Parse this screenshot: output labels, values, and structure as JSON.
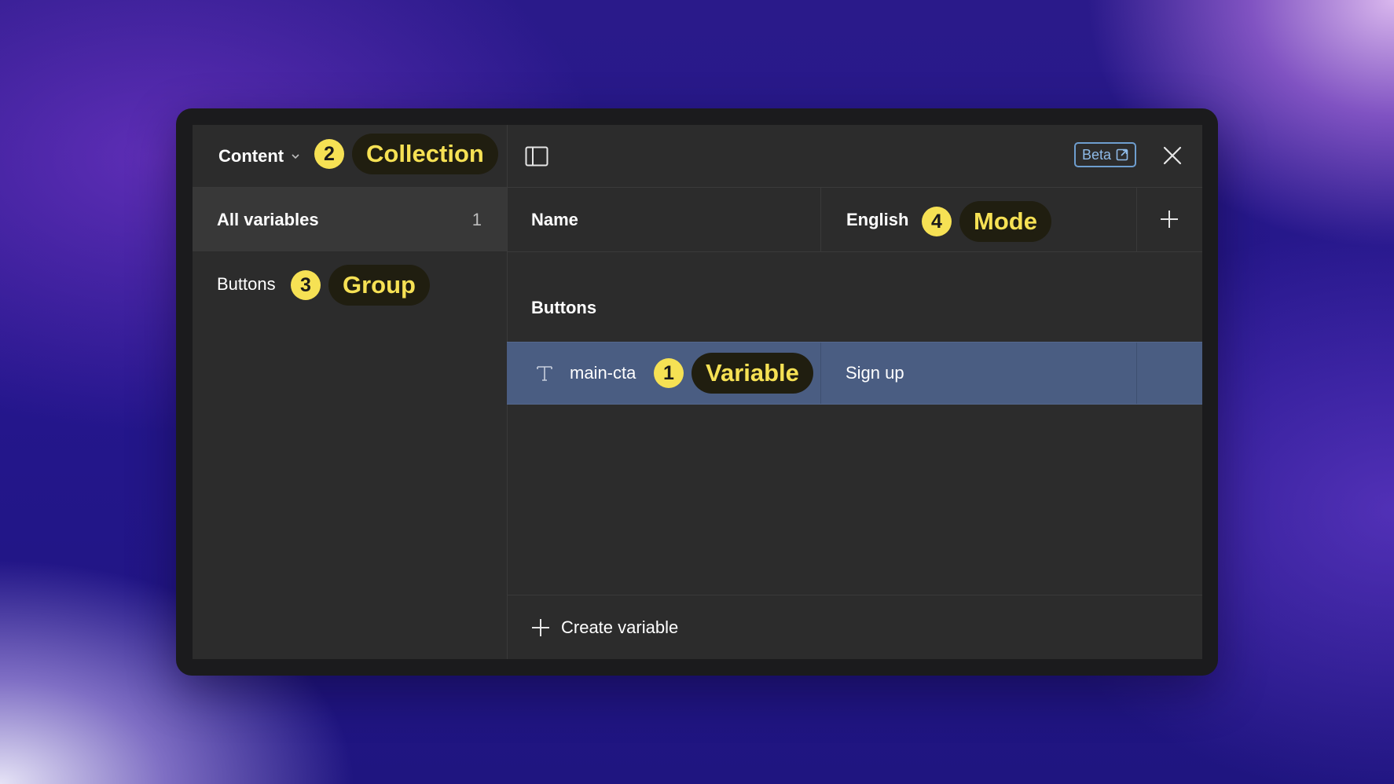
{
  "sidebar": {
    "collection_name": "Content",
    "all_variables_label": "All variables",
    "all_variables_count": "1",
    "group_label": "Buttons"
  },
  "topbar": {
    "beta_label": "Beta"
  },
  "table": {
    "name_header": "Name",
    "mode_header": "English",
    "group_heading": "Buttons",
    "rows": [
      {
        "name": "main-cta",
        "value": "Sign up",
        "type_icon": "text-type-icon"
      }
    ]
  },
  "footer": {
    "create_label": "Create variable"
  },
  "callouts": {
    "collection": {
      "number": "2",
      "label": "Collection"
    },
    "group": {
      "number": "3",
      "label": "Group"
    },
    "variable": {
      "number": "1",
      "label": "Variable"
    },
    "mode": {
      "number": "4",
      "label": "Mode"
    }
  },
  "colors": {
    "callout_accent": "#f6e154",
    "selected_row": "#4a5d82",
    "beta_border": "#6e9ecf"
  }
}
